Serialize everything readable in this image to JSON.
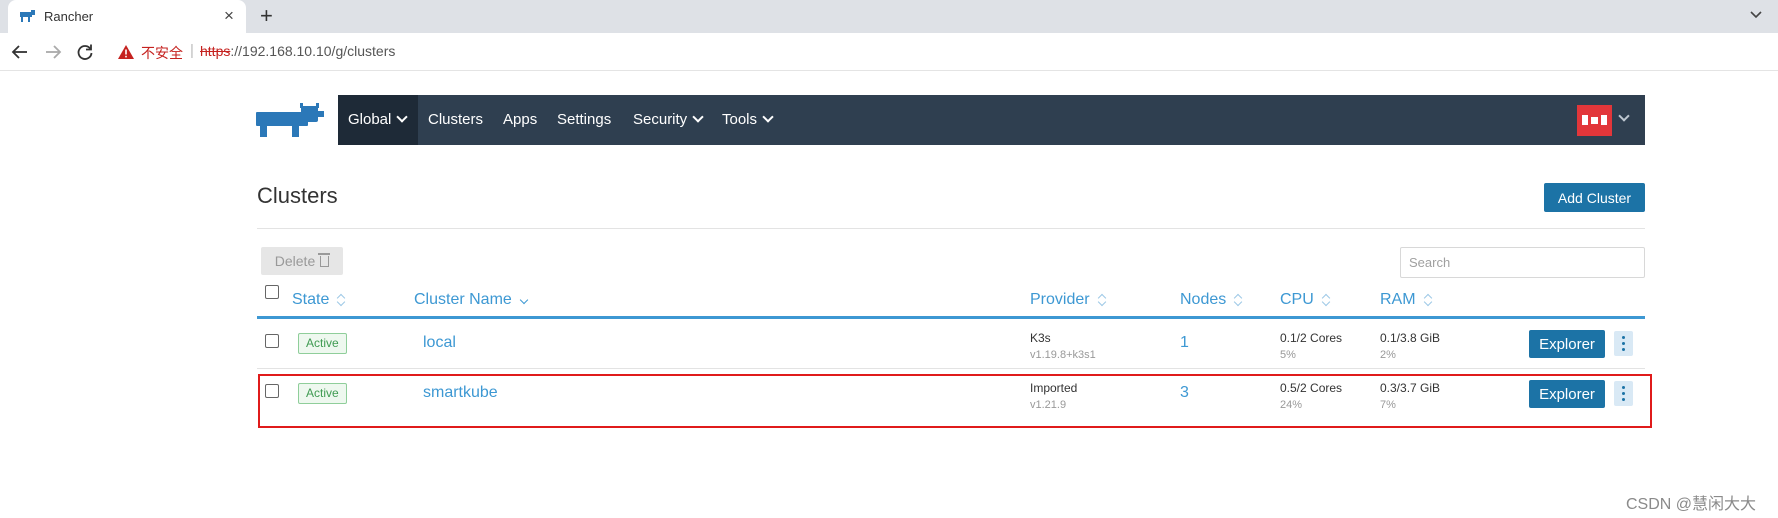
{
  "browser": {
    "tab_title": "Rancher",
    "tab_close": "×",
    "new_tab": "+",
    "insecure_label": "不安全",
    "url_scheme": "https",
    "url_rest": "://192.168.10.10/g/clusters"
  },
  "nav": {
    "global": "Global",
    "items": [
      "Clusters",
      "Apps",
      "Settings",
      "Security",
      "Tools"
    ]
  },
  "page": {
    "title": "Clusters",
    "add_button": "Add Cluster",
    "delete_button": "Delete",
    "search_placeholder": "Search"
  },
  "table": {
    "columns": [
      "State",
      "Cluster Name",
      "Provider",
      "Nodes",
      "CPU",
      "RAM"
    ],
    "rows": [
      {
        "state": "Active",
        "name": "local",
        "provider": "K3s",
        "provider_version": "v1.19.8+k3s1",
        "nodes": "1",
        "cpu": "0.1/2 Cores",
        "cpu_pct": "5%",
        "ram": "0.1/3.8 GiB",
        "ram_pct": "2%",
        "action": "Explorer"
      },
      {
        "state": "Active",
        "name": "smartkube",
        "provider": "Imported",
        "provider_version": "v1.21.9",
        "nodes": "3",
        "cpu": "0.5/2 Cores",
        "cpu_pct": "24%",
        "ram": "0.3/3.7 GiB",
        "ram_pct": "7%",
        "action": "Explorer"
      }
    ]
  },
  "watermark": "CSDN @慧闲大大",
  "colors": {
    "nav_bg": "#2f3f50",
    "nav_active_bg": "#1e2a37",
    "primary": "#1c73a6",
    "link": "#3d98d3",
    "active_green": "#3f9b52",
    "highlight_red": "#e01b1b"
  }
}
